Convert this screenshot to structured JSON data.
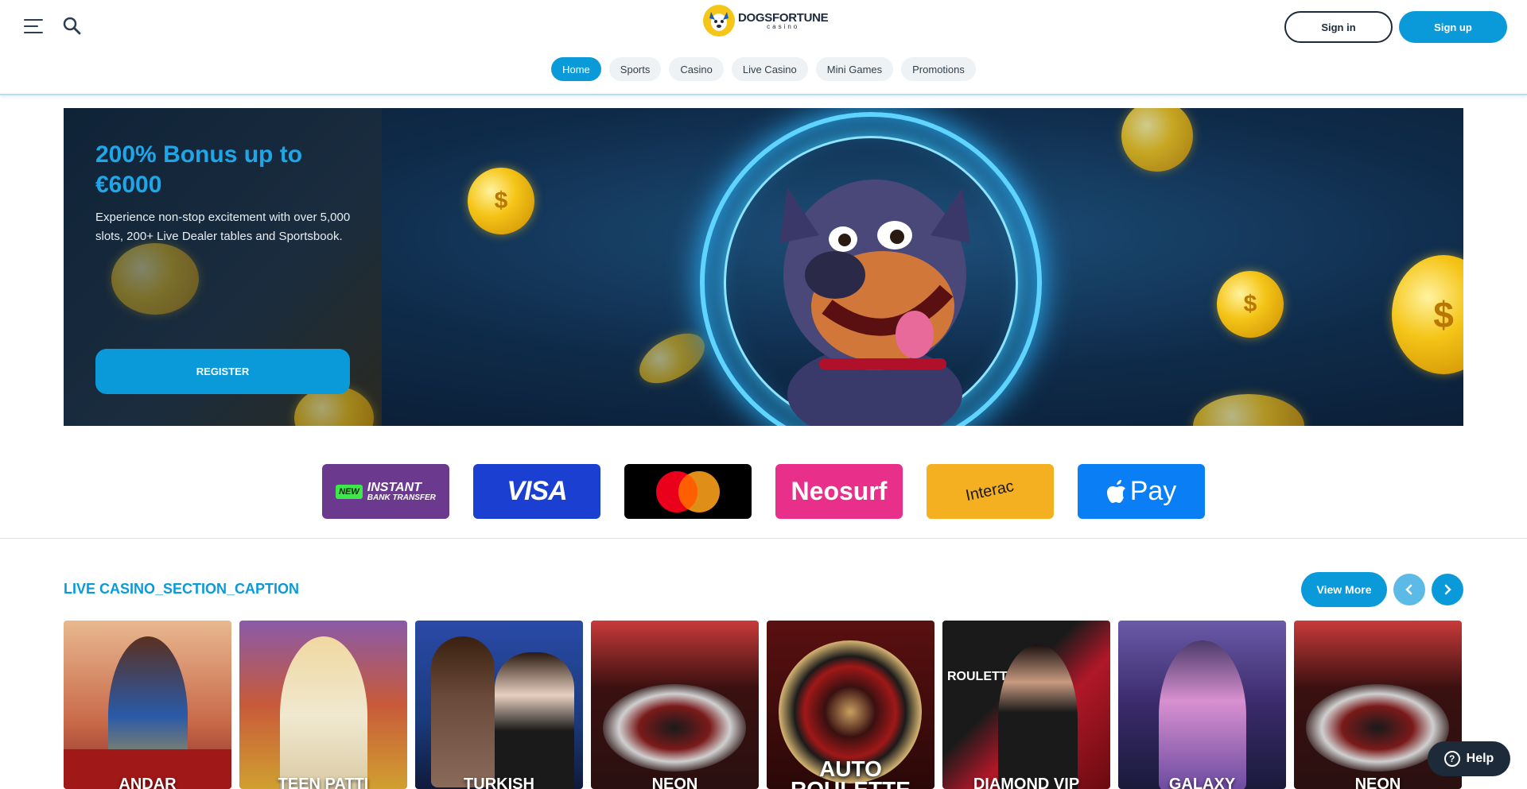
{
  "header": {
    "logo_main": "DOGSFORTUNE",
    "logo_sub": "casino",
    "signin_label": "Sign in",
    "signup_label": "Sign up",
    "nav": [
      {
        "label": "Home",
        "active": true
      },
      {
        "label": "Sports",
        "active": false
      },
      {
        "label": "Casino",
        "active": false
      },
      {
        "label": "Live Casino",
        "active": false
      },
      {
        "label": "Mini Games",
        "active": false
      },
      {
        "label": "Promotions",
        "active": false
      }
    ]
  },
  "hero": {
    "title": "200% Bonus up to €6000",
    "description": "Experience non-stop excitement with over 5,000 slots, 200+ Live Dealer tables and Sportsbook.",
    "register_label": "REGISTER"
  },
  "payments": [
    {
      "name": "Instant Bank Transfer",
      "badge": "NEW",
      "line1": "INSTANT",
      "line2": "BANK TRANSFER",
      "color": "#6b3a8f"
    },
    {
      "name": "Visa",
      "label": "VISA",
      "color": "#1a3fd1"
    },
    {
      "name": "Mastercard",
      "color": "#000000"
    },
    {
      "name": "Neosurf",
      "label": "Neosurf",
      "color": "#e8308a"
    },
    {
      "name": "Interac",
      "label": "Interac",
      "color": "#f5b021"
    },
    {
      "name": "Apple Pay",
      "label": "Pay",
      "color": "#0a7ff5"
    }
  ],
  "live_casino": {
    "caption": "LIVE CASINO_SECTION_CAPTION",
    "view_more_label": "View More",
    "games": [
      {
        "label": "ANDAR",
        "bg": "#c96a4a"
      },
      {
        "label": "TEEN PATTI",
        "bg": "#c85a3a"
      },
      {
        "label": "TURKISH",
        "bg": "#1a3a7a"
      },
      {
        "label": "NEON",
        "bg": "#7a1a1a"
      },
      {
        "label": "AUTO ROULETTE",
        "bg": "#3a1010"
      },
      {
        "label": "DIAMOND VIP",
        "top_label": "ROULETTE",
        "bg": "#8a1020"
      },
      {
        "label": "GALAXY",
        "bg": "#3a2a6a"
      },
      {
        "label": "NEON",
        "bg": "#7a1a1a"
      }
    ]
  },
  "help_label": "Help"
}
